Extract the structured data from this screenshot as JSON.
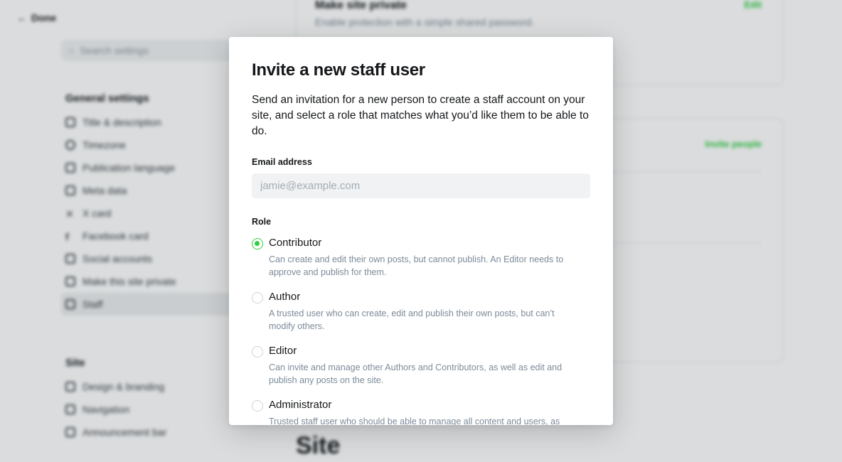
{
  "background": {
    "back_label": "Done",
    "search_placeholder": "Search settings",
    "general_settings_title": "General settings",
    "general_items": [
      {
        "label": "Title & description",
        "icon": "text-icon"
      },
      {
        "label": "Timezone",
        "icon": "clock-icon"
      },
      {
        "label": "Publication language",
        "icon": "language-icon"
      },
      {
        "label": "Meta data",
        "icon": "database-icon"
      },
      {
        "label": "X card",
        "icon": "x-icon"
      },
      {
        "label": "Facebook card",
        "icon": "facebook-icon"
      },
      {
        "label": "Social accounts",
        "icon": "hand-icon"
      },
      {
        "label": "Make this site private",
        "icon": "lock-icon"
      },
      {
        "label": "Staff",
        "icon": "staff-icon"
      }
    ],
    "site_title": "Site",
    "site_items": [
      {
        "label": "Design & branding",
        "icon": "brush-icon"
      },
      {
        "label": "Navigation",
        "icon": "navigation-icon"
      },
      {
        "label": "Announcement bar",
        "icon": "megaphone-icon"
      }
    ],
    "private_card": {
      "title": "Make site private",
      "subtitle": "Enable protection with a simple shared password.",
      "action": "Edit"
    },
    "staff_card": {
      "action": "Invite people"
    },
    "site_heading": "Site",
    "accent_color": "#30cf43"
  },
  "modal": {
    "title": "Invite a new staff user",
    "description": "Send an invitation for a new person to create a staff account on your site, and select a role that matches what you’d like them to be able to do.",
    "email": {
      "label": "Email address",
      "placeholder": "jamie@example.com",
      "value": ""
    },
    "role_label": "Role",
    "roles": [
      {
        "name": "Contributor",
        "description": "Can create and edit their own posts, but cannot publish. An Editor needs to approve and publish for them.",
        "selected": true
      },
      {
        "name": "Author",
        "description": "A trusted user who can create, edit and publish their own posts, but can’t modify others.",
        "selected": false
      },
      {
        "name": "Editor",
        "description": "Can invite and manage other Authors and Contributors, as well as edit and publish any posts on the site.",
        "selected": false
      },
      {
        "name": "Administrator",
        "description": "Trusted staff user who should be able to manage all content and users, as",
        "selected": false
      }
    ]
  }
}
